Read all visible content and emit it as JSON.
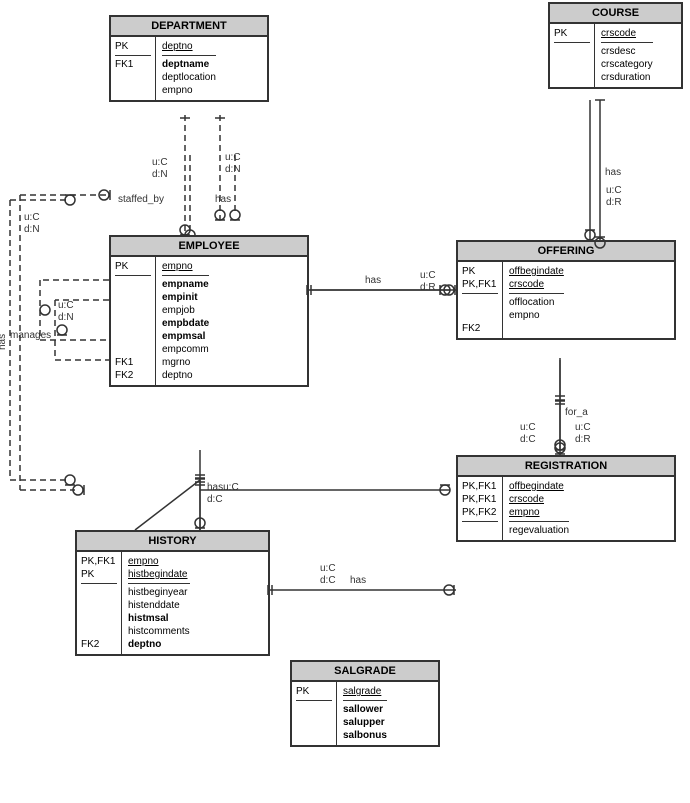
{
  "entities": {
    "department": {
      "title": "DEPARTMENT",
      "keys": [
        {
          "label": "PK",
          "attr": "deptno",
          "underline": true,
          "bold": false,
          "dividerAfter": true
        }
      ],
      "attrs": [
        {
          "text": "deptname",
          "bold": true
        },
        {
          "text": "deptlocation",
          "bold": false
        },
        {
          "text": "empno",
          "bold": false
        }
      ],
      "fks": [
        {
          "label": "FK1"
        }
      ]
    },
    "course": {
      "title": "COURSE",
      "keys": [
        {
          "label": "PK",
          "attr": "crscode",
          "underline": true,
          "bold": false,
          "dividerAfter": true
        }
      ],
      "attrs": [
        {
          "text": "crsdesc",
          "bold": false
        },
        {
          "text": "crscategory",
          "bold": false
        },
        {
          "text": "crsduration",
          "bold": false
        }
      ],
      "fks": []
    },
    "employee": {
      "title": "EMPLOYEE",
      "keys": [
        {
          "label": "PK",
          "attr": "empno",
          "underline": true,
          "bold": false,
          "dividerAfter": true
        }
      ],
      "attrs": [
        {
          "text": "empname",
          "bold": true
        },
        {
          "text": "empinit",
          "bold": true
        },
        {
          "text": "empjob",
          "bold": false
        },
        {
          "text": "empbdate",
          "bold": true
        },
        {
          "text": "empmsal",
          "bold": true
        },
        {
          "text": "empcomm",
          "bold": false
        },
        {
          "text": "mgrno",
          "bold": false
        },
        {
          "text": "deptno",
          "bold": false
        }
      ],
      "fks": [
        {
          "label": "FK1"
        },
        {
          "label": "FK2"
        }
      ]
    },
    "offering": {
      "title": "OFFERING",
      "keys": [
        {
          "label": "PK",
          "attr": "offbegindate",
          "underline": true
        },
        {
          "label": "PK,FK1",
          "attr": "crscode",
          "underline": true,
          "dividerAfter": true
        }
      ],
      "attrs": [
        {
          "text": "offlocation",
          "bold": false
        },
        {
          "text": "empno",
          "bold": false
        }
      ],
      "fks": [
        {
          "label": "FK2"
        }
      ]
    },
    "history": {
      "title": "HISTORY",
      "keys": [
        {
          "label": "PK,FK1",
          "attr": "empno",
          "underline": true
        },
        {
          "label": "PK",
          "attr": "histbegindate",
          "underline": true,
          "dividerAfter": true
        }
      ],
      "attrs": [
        {
          "text": "histbeginyear",
          "bold": false
        },
        {
          "text": "histenddate",
          "bold": false
        },
        {
          "text": "histmsal",
          "bold": true
        },
        {
          "text": "histcomments",
          "bold": false
        },
        {
          "text": "deptno",
          "bold": true
        }
      ],
      "fks": [
        {
          "label": "FK2"
        }
      ]
    },
    "registration": {
      "title": "REGISTRATION",
      "keys": [
        {
          "label": "PK,FK1",
          "attr": "offbegindate",
          "underline": true
        },
        {
          "label": "PK,FK1",
          "attr": "crscode",
          "underline": true
        },
        {
          "label": "PK,FK2",
          "attr": "empno",
          "underline": true,
          "dividerAfter": true
        }
      ],
      "attrs": [
        {
          "text": "regevaluation",
          "bold": false
        }
      ],
      "fks": []
    },
    "salgrade": {
      "title": "SALGRADE",
      "keys": [
        {
          "label": "PK",
          "attr": "salgrade",
          "underline": true,
          "dividerAfter": true
        }
      ],
      "attrs": [
        {
          "text": "sallower",
          "bold": true
        },
        {
          "text": "salupper",
          "bold": true
        },
        {
          "text": "salbonus",
          "bold": true
        }
      ],
      "fks": []
    }
  },
  "labels": {
    "staffed_by": "staffed_by",
    "has_dept_emp": "has",
    "has_emp_offering": "has",
    "has_emp_history": "has",
    "has_offering_registration": "for_a",
    "manages": "manages",
    "has_left": "has",
    "u_c_d_n_1": "u:C\nd:N",
    "u_c_d_r_1": "u:C\nd:R",
    "u_c_d_r_2": "u:C\nd:R",
    "u_c_d_n_2": "u:C\nd:N",
    "hasu_c": "hasu:C",
    "d_c": "d:C",
    "u_c_d_c": "u:C\nd:C",
    "u_c_d_r_3": "u:C\nd:R",
    "u_c_d_n_3": "u:C\nd:N",
    "u_c_d_n_4": "u:C\nd:N"
  }
}
